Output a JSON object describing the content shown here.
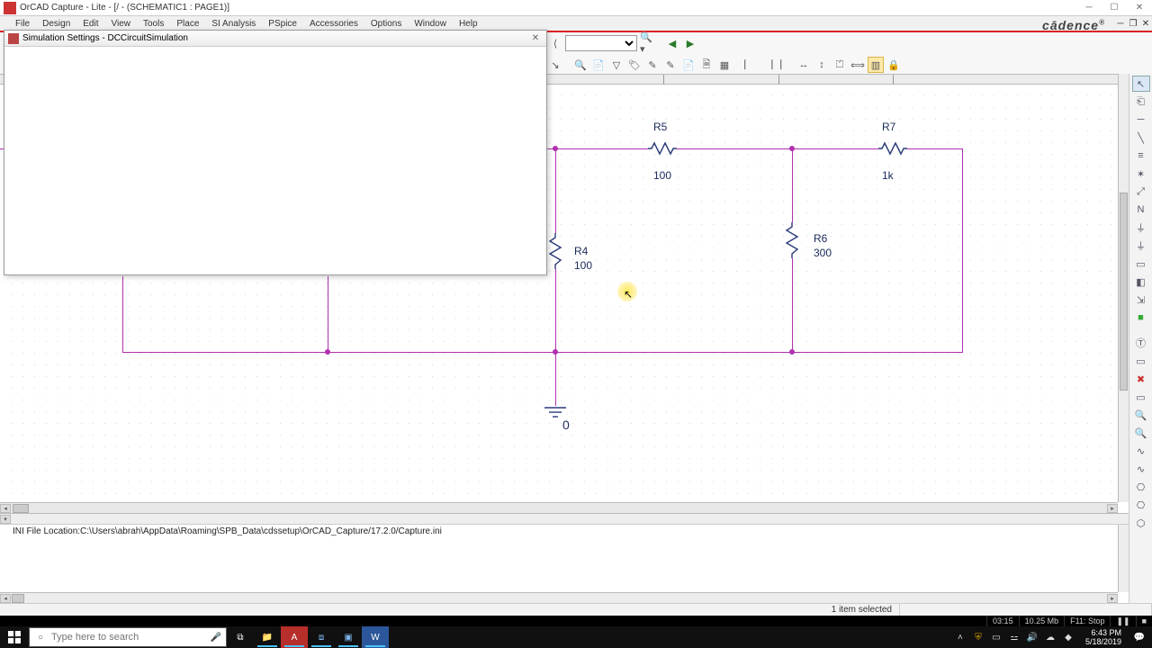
{
  "window": {
    "title": "OrCAD Capture - Lite - [/ - (SCHEMATIC1 : PAGE1)]"
  },
  "menu": {
    "items": [
      "File",
      "Design",
      "Edit",
      "View",
      "Tools",
      "Place",
      "SI Analysis",
      "PSpice",
      "Accessories",
      "Options",
      "Window",
      "Help"
    ],
    "brand": "cādence"
  },
  "dialog": {
    "title": "Simulation Settings - DCCircuitSimulation"
  },
  "ruler": {
    "ticks_x": [
      737,
      865,
      992
    ]
  },
  "schematic": {
    "r5": {
      "name": "R5",
      "value": "100"
    },
    "r7": {
      "name": "R7",
      "value": "1k"
    },
    "r4": {
      "name": "R4",
      "value": "100"
    },
    "r6": {
      "name": "R6",
      "value": "300"
    },
    "gnd": "0"
  },
  "log": {
    "line1": "INI File Location:C:\\Users\\abrah\\AppData\\Roaming\\SPB_Data\\cdssetup\\OrCAD_Capture/17.2.0/Capture.ini"
  },
  "status": {
    "selected": "1 item selected"
  },
  "video": {
    "elapsed": "03:15",
    "mem": "10.25 Mb",
    "fps": "F11: Stop",
    "pause": "❚❚",
    "stop": "■"
  },
  "taskbar": {
    "search_placeholder": "Type here to search",
    "clock_time": "6:43 PM",
    "clock_date": "5/18/2019"
  }
}
